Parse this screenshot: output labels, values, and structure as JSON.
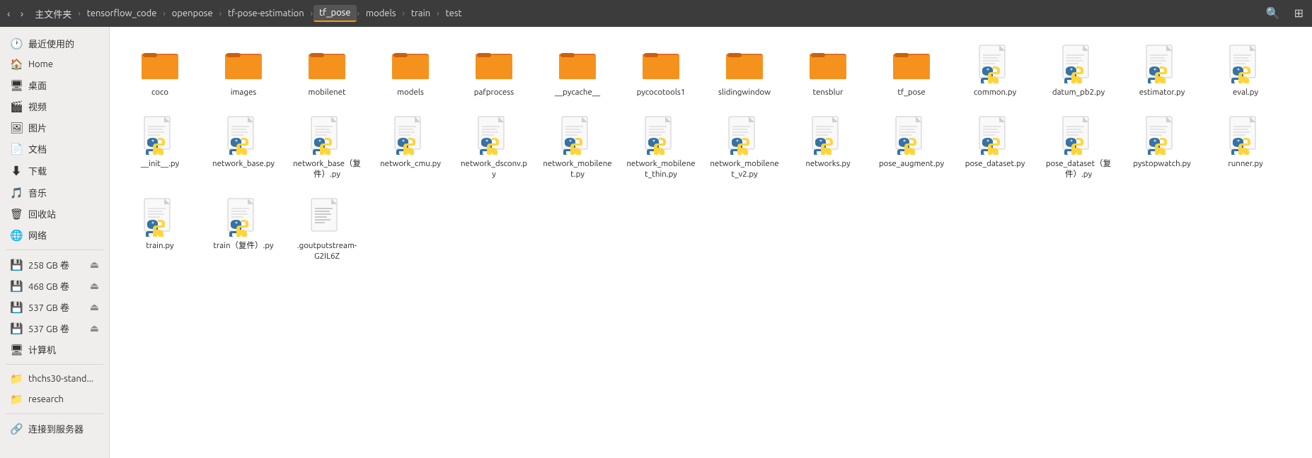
{
  "toolbar": {
    "nav_back": "‹",
    "nav_forward": "›",
    "breadcrumbs": [
      {
        "id": "home",
        "label": "主文件夹",
        "active": false
      },
      {
        "id": "tensorflow_code",
        "label": "tensorflow_code",
        "active": false
      },
      {
        "id": "openpose",
        "label": "openpose",
        "active": false
      },
      {
        "id": "tf-pose-estimation",
        "label": "tf-pose-estimation",
        "active": false
      },
      {
        "id": "tf_pose",
        "label": "tf_pose",
        "active": true
      },
      {
        "id": "models",
        "label": "models",
        "active": false
      },
      {
        "id": "train",
        "label": "train",
        "active": false
      },
      {
        "id": "test",
        "label": "test",
        "active": false
      }
    ],
    "search_icon": "🔍",
    "view_icon": "⊞"
  },
  "sidebar": {
    "items": [
      {
        "id": "recent",
        "icon": "🕐",
        "label": "最近使用的",
        "type": "item"
      },
      {
        "id": "home",
        "icon": "🏠",
        "label": "Home",
        "type": "item"
      },
      {
        "id": "desktop",
        "icon": "🖥",
        "label": "桌面",
        "type": "item"
      },
      {
        "id": "video",
        "icon": "🎬",
        "label": "视频",
        "type": "item"
      },
      {
        "id": "pictures",
        "icon": "🖼",
        "label": "图片",
        "type": "item"
      },
      {
        "id": "documents",
        "icon": "📄",
        "label": "文档",
        "type": "item"
      },
      {
        "id": "downloads",
        "icon": "⬇",
        "label": "下载",
        "type": "item"
      },
      {
        "id": "music",
        "icon": "🎵",
        "label": "音乐",
        "type": "item"
      },
      {
        "id": "trash",
        "icon": "🗑",
        "label": "回收站",
        "type": "item"
      },
      {
        "id": "network",
        "icon": "🌐",
        "label": "网络",
        "type": "item"
      },
      {
        "id": "divider1",
        "type": "divider"
      },
      {
        "id": "vol258",
        "icon": "💾",
        "label": "258 GB 卷",
        "type": "item",
        "eject": true
      },
      {
        "id": "vol468",
        "icon": "💾",
        "label": "468 GB 卷",
        "type": "item",
        "eject": true
      },
      {
        "id": "vol537a",
        "icon": "💾",
        "label": "537 GB 卷",
        "type": "item",
        "eject": true
      },
      {
        "id": "vol537b",
        "icon": "💾",
        "label": "537 GB 卷",
        "type": "item",
        "eject": "⏏"
      },
      {
        "id": "computer",
        "icon": "🖥",
        "label": "计算机",
        "type": "item"
      },
      {
        "id": "divider2",
        "type": "divider"
      },
      {
        "id": "thchs30",
        "icon": "📁",
        "label": "thchs30-stand...",
        "type": "item"
      },
      {
        "id": "research",
        "icon": "📁",
        "label": "research",
        "type": "item"
      },
      {
        "id": "divider3",
        "type": "divider"
      },
      {
        "id": "connect",
        "icon": "🔗",
        "label": "连接到服务器",
        "type": "item"
      }
    ]
  },
  "files": [
    {
      "id": "coco",
      "name": "coco",
      "type": "folder"
    },
    {
      "id": "images",
      "name": "images",
      "type": "folder"
    },
    {
      "id": "mobilenet",
      "name": "mobilenet",
      "type": "folder"
    },
    {
      "id": "models",
      "name": "models",
      "type": "folder"
    },
    {
      "id": "pafprocess",
      "name": "pafprocess",
      "type": "folder"
    },
    {
      "id": "__pycache__",
      "name": "__pycache__",
      "type": "folder"
    },
    {
      "id": "pycocotools1",
      "name": "pycocotools1",
      "type": "folder"
    },
    {
      "id": "slidingwindow",
      "name": "slidingwindow",
      "type": "folder"
    },
    {
      "id": "tensblur",
      "name": "tensblur",
      "type": "folder"
    },
    {
      "id": "tf_pose",
      "name": "tf_pose",
      "type": "folder"
    },
    {
      "id": "common_py",
      "name": "common.py",
      "type": "python"
    },
    {
      "id": "datum_pb2_py",
      "name": "datum_pb2.py",
      "type": "python"
    },
    {
      "id": "estimator_py",
      "name": "estimator.py",
      "type": "python"
    },
    {
      "id": "eval_py",
      "name": "eval.py",
      "type": "python"
    },
    {
      "id": "init_py",
      "name": "__init__.py",
      "type": "python"
    },
    {
      "id": "network_base_py",
      "name": "network_base.py",
      "type": "python"
    },
    {
      "id": "network_base_copy_py",
      "name": "network_base（复件）.py",
      "type": "python"
    },
    {
      "id": "network_cmu_py",
      "name": "network_cmu.py",
      "type": "python"
    },
    {
      "id": "network_dsconv_py",
      "name": "network_dsconv.py",
      "type": "python"
    },
    {
      "id": "network_mobilenet_py",
      "name": "network_mobilenet.py",
      "type": "python"
    },
    {
      "id": "network_mobilenet_thin_py",
      "name": "network_mobilenet_thin.py",
      "type": "python"
    },
    {
      "id": "network_mobilenet_v2_py",
      "name": "network_mobilenet_v2.py",
      "type": "python"
    },
    {
      "id": "networks_py",
      "name": "networks.py",
      "type": "python"
    },
    {
      "id": "pose_augment_py",
      "name": "pose_augment.py",
      "type": "python"
    },
    {
      "id": "pose_dataset_py",
      "name": "pose_dataset.py",
      "type": "python"
    },
    {
      "id": "pose_dataset_copy_py",
      "name": "pose_dataset（复件）.py",
      "type": "python"
    },
    {
      "id": "pystopwatch_py",
      "name": "pystopwatch.py",
      "type": "python"
    },
    {
      "id": "runner_py",
      "name": "runner.py",
      "type": "python"
    },
    {
      "id": "train_py",
      "name": "train.py",
      "type": "python"
    },
    {
      "id": "train_copy_py",
      "name": "train（复件）.py",
      "type": "python"
    },
    {
      "id": "goutputstream",
      "name": ".goutputstream-G2IL6Z",
      "type": "text"
    }
  ]
}
